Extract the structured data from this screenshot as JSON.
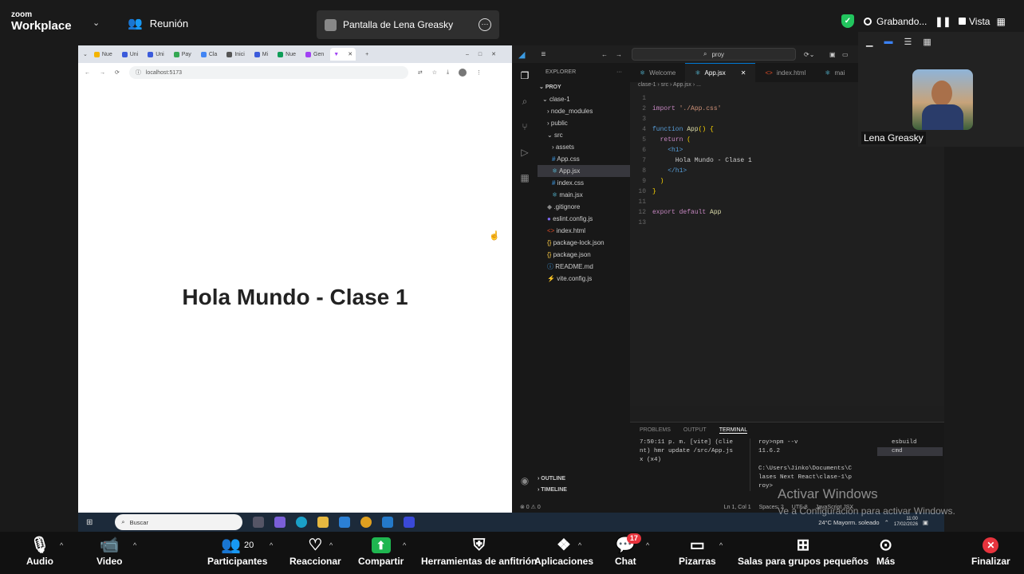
{
  "topbar": {
    "logo_line1": "zoom",
    "logo_line2": "Workplace",
    "meeting_label": "Reunión",
    "share_title": "Pantalla de Lena Greasky",
    "recording_label": "Grabando...",
    "view_label": "Vista"
  },
  "browser": {
    "tabs": [
      "Nue",
      "Uni",
      "Uni",
      "Pay",
      "Cla",
      "Inici",
      "Mi",
      "Nue",
      "Gen"
    ],
    "url": "localhost:5173",
    "heading": "Hola Mundo - Clase 1"
  },
  "vscode": {
    "search": "proy",
    "explorer_title": "EXPLORER",
    "project": "PROY",
    "tree": [
      {
        "label": "clase-1",
        "indent": 1,
        "icon": "⌄"
      },
      {
        "label": "node_modules",
        "indent": 2,
        "icon": "›"
      },
      {
        "label": "public",
        "indent": 2,
        "icon": "›"
      },
      {
        "label": "src",
        "indent": 2,
        "icon": "⌄"
      },
      {
        "label": "assets",
        "indent": 3,
        "icon": "›"
      },
      {
        "label": "App.css",
        "indent": 3,
        "icon": "#"
      },
      {
        "label": "App.jsx",
        "indent": 3,
        "icon": "⚛",
        "selected": true
      },
      {
        "label": "index.css",
        "indent": 3,
        "icon": "#"
      },
      {
        "label": "main.jsx",
        "indent": 3,
        "icon": "⚛"
      },
      {
        "label": ".gitignore",
        "indent": 2,
        "icon": "◆"
      },
      {
        "label": "eslint.config.js",
        "indent": 2,
        "icon": "●"
      },
      {
        "label": "index.html",
        "indent": 2,
        "icon": "<>"
      },
      {
        "label": "package-lock.json",
        "indent": 2,
        "icon": "{}"
      },
      {
        "label": "package.json",
        "indent": 2,
        "icon": "{}"
      },
      {
        "label": "README.md",
        "indent": 2,
        "icon": "ⓘ"
      },
      {
        "label": "vite.config.js",
        "indent": 2,
        "icon": "⚡"
      }
    ],
    "tabs": [
      "Welcome",
      "App.jsx",
      "index.html",
      "mai"
    ],
    "breadcrumb": "clase-1 › src › App.jsx › ...",
    "code_lines": [
      {
        "n": "1",
        "html": ""
      },
      {
        "n": "2",
        "html": "<span class='k'>import</span> <span class='s'>'./App.css'</span>"
      },
      {
        "n": "3",
        "html": ""
      },
      {
        "n": "4",
        "html": "<span class='t'>function</span> <span class='f'>App</span><span class='p'>()</span> <span class='p'>{</span>"
      },
      {
        "n": "5",
        "html": "&nbsp;&nbsp;<span class='k'>return</span> <span class='p'>(</span>"
      },
      {
        "n": "6",
        "html": "&nbsp;&nbsp;&nbsp;&nbsp;<span class='t'>&lt;h1&gt;</span>"
      },
      {
        "n": "7",
        "html": "&nbsp;&nbsp;&nbsp;&nbsp;&nbsp;&nbsp;Hola Mundo - Clase 1"
      },
      {
        "n": "8",
        "html": "&nbsp;&nbsp;&nbsp;&nbsp;<span class='t'>&lt;/h1&gt;</span>"
      },
      {
        "n": "9",
        "html": "&nbsp;&nbsp;<span class='p'>)</span>"
      },
      {
        "n": "10",
        "html": "<span class='p'>}</span>"
      },
      {
        "n": "11",
        "html": ""
      },
      {
        "n": "12",
        "html": "<span class='k'>export</span> <span class='k'>default</span> <span class='f'>App</span>"
      },
      {
        "n": "13",
        "html": ""
      }
    ],
    "panel_tabs": [
      "PROBLEMS",
      "OUTPUT",
      "TERMINAL"
    ],
    "terminal_left": [
      "7:50:11 p. m. [vite] (clie",
      "nt) hmr update /src/App.js",
      "x (x4)"
    ],
    "terminal_right": [
      "roy>npm --v",
      "11.6.2",
      "",
      "C:\\Users\\Jinko\\Documents\\C",
      "lases Next React\\clase-1\\p",
      "roy>"
    ],
    "terminal_list": [
      "esbuild",
      "cmd"
    ],
    "outline": "OUTLINE",
    "timeline": "TIMELINE",
    "status": {
      "errors": "⊗ 0 ⚠ 0",
      "pos": "Ln 1, Col 1",
      "spaces": "Spaces: 2",
      "enc": "UTF-8",
      "lang": "JavaScript JSX"
    }
  },
  "taskbar": {
    "search": "Buscar",
    "weather": "24°C Mayorm. soleado",
    "time": "11:00",
    "date": "17/02/2026"
  },
  "watermark": {
    "title": "Activar Windows",
    "sub": "Ve a Configuración para activar Windows."
  },
  "selfview": {
    "name": "Lena Greasky"
  },
  "bottombar": {
    "audio": "Audio",
    "video": "Video",
    "participants": "Participantes",
    "participants_count": "20",
    "react": "Reaccionar",
    "share": "Compartir",
    "host_tools": "Herramientas de anfitrión",
    "apps": "Aplicaciones",
    "chat": "Chat",
    "chat_badge": "17",
    "whiteboards": "Pizarras",
    "breakout": "Salas para grupos pequeños",
    "more": "Más",
    "end": "Finalizar"
  },
  "colors": {
    "accent_green": "#22c55e",
    "share_green": "#1fb650",
    "end_red": "#e8333d"
  }
}
